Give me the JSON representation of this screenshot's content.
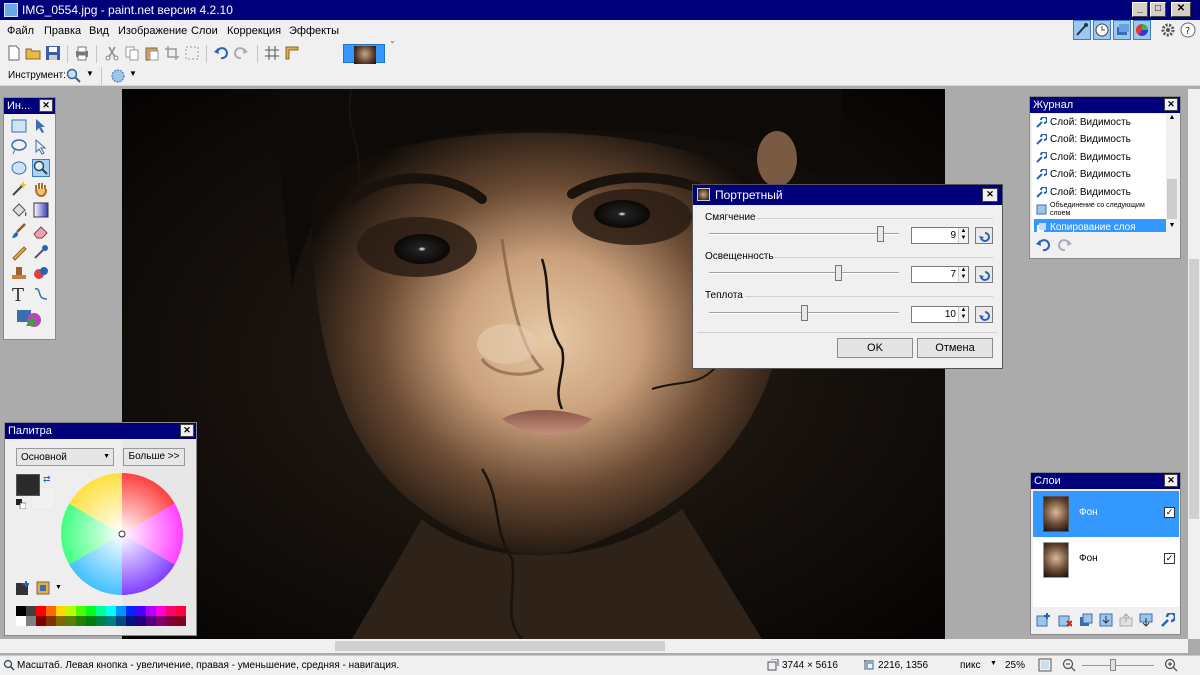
{
  "window": {
    "title": "IMG_0554.jpg - paint.net версия 4.2.10"
  },
  "menu": [
    "Файл",
    "Правка",
    "Вид",
    "Изображение",
    "Слои",
    "Коррекция",
    "Эффекты"
  ],
  "toolbar2": {
    "tool_label": "Инструмент:"
  },
  "tools": {
    "title": "Ин..."
  },
  "palette": {
    "title": "Палитра",
    "select_value": "Основной",
    "more_button": "Больше >>",
    "primary_color": "#2a2a2a",
    "secondary_color": "#ffffff"
  },
  "history": {
    "title": "Журнал",
    "items": [
      {
        "label": "Слой: Видимость"
      },
      {
        "label": "Слой: Видимость"
      },
      {
        "label": "Слой: Видимость"
      },
      {
        "label": "Слой: Видимость"
      },
      {
        "label": "Слой: Видимость"
      },
      {
        "label": "Объединение со следующим слоем"
      },
      {
        "label": "Копирование слоя",
        "selected": true
      }
    ]
  },
  "dialog": {
    "title": "Портретный",
    "sliders": [
      {
        "label": "Смягчение",
        "value": "9",
        "fraction": 0.9
      },
      {
        "label": "Освещенность",
        "value": "7",
        "fraction": 0.68
      },
      {
        "label": "Теплота",
        "value": "10",
        "fraction": 0.5
      }
    ],
    "ok": "OK",
    "cancel": "Отмена"
  },
  "layers": {
    "title": "Слои",
    "items": [
      {
        "name": "Фон",
        "checked": true,
        "selected": true
      },
      {
        "name": "Фон",
        "checked": true,
        "selected": false
      }
    ]
  },
  "status": {
    "hint": "Масштаб. Левая кнопка - увеличение, правая - уменьшение, средняя - навигация.",
    "image_size": "3744 × 5616",
    "cursor_pos": "2216, 1356",
    "units": "пикс",
    "zoom": "25%"
  },
  "colors": {
    "accent": "#00007a",
    "selection": "#3399ff"
  }
}
